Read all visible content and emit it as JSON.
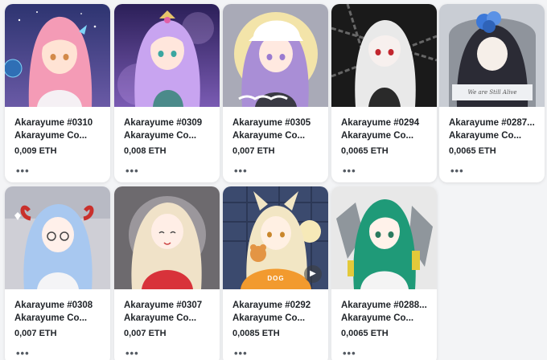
{
  "cards": [
    {
      "title": "Akarayume #0310",
      "collection": "Akarayume Co...",
      "price": "0,009 ETH",
      "more_label": "•••",
      "palette": {
        "bg": "#3a3f7a",
        "hair": "#f49bb6",
        "accent": "#7fd3f7",
        "skin": "#ffe3d4"
      }
    },
    {
      "title": "Akarayume #0309",
      "collection": "Akarayume Co...",
      "price": "0,008 ETH",
      "more_label": "•••",
      "palette": {
        "bg": "#3b2a6b",
        "hair": "#c8a4f0",
        "accent": "#7fe0d6",
        "skin": "#ffe6dc"
      }
    },
    {
      "title": "Akarayume #0305",
      "collection": "Akarayume Co...",
      "price": "0,007 ETH",
      "more_label": "•••",
      "palette": {
        "bg": "#a9aab7",
        "hair": "#a98ed6",
        "accent": "#f3e4a9",
        "skin": "#ffe9e0"
      }
    },
    {
      "title": "Akarayume #0294",
      "collection": "Akarayume Co...",
      "price": "0,0065 ETH",
      "more_label": "•••",
      "palette": {
        "bg": "#1a1a1a",
        "hair": "#e9e9e9",
        "accent": "#c2262e",
        "skin": "#f7f0ee"
      }
    },
    {
      "title": "Akarayume #0287...",
      "collection": "Akarayume Co...",
      "price": "0,0065 ETH",
      "more_label": "•••",
      "palette": {
        "bg": "#c9cdd4",
        "hair": "#2b2b35",
        "accent": "#3c78d8",
        "skin": "#f6efe9"
      },
      "banner_text": "We are Still Alive"
    },
    {
      "title": "Akarayume #0308",
      "collection": "Akarayume Co...",
      "price": "0,007 ETH",
      "more_label": "•••",
      "palette": {
        "bg": "#cfcfd6",
        "hair": "#a8c8f0",
        "accent": "#c9302c",
        "skin": "#fff0ea"
      }
    },
    {
      "title": "Akarayume #0307",
      "collection": "Akarayume Co...",
      "price": "0,007 ETH",
      "more_label": "•••",
      "palette": {
        "bg": "#6d6a6e",
        "hair": "#f0e2c8",
        "accent": "#d8323a",
        "skin": "#ffeee6"
      }
    },
    {
      "title": "Akarayume #0292",
      "collection": "Akarayume Co...",
      "price": "0,0085 ETH",
      "more_label": "•••",
      "palette": {
        "bg": "#3b4a6e",
        "hair": "#f2e6c4",
        "accent": "#f29a2e",
        "skin": "#fff0e3"
      },
      "hoodie_text": "DOG",
      "has_play": true
    },
    {
      "title": "Akarayume #0288...",
      "collection": "Akarayume Co...",
      "price": "0,0065 ETH",
      "more_label": "•••",
      "palette": {
        "bg": "#e8e8e8",
        "hair": "#1f9a78",
        "accent": "#e3c93a",
        "skin": "#fff2ea"
      }
    }
  ],
  "icons": {
    "play": "play-icon",
    "more": "more-options-icon"
  }
}
